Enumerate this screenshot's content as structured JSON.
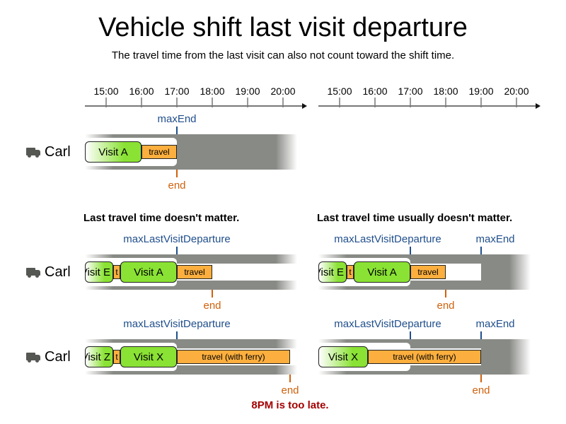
{
  "title": "Vehicle shift last visit departure",
  "subtitle": "The travel time from the last visit can also not count toward the shift time.",
  "axes": {
    "tick_labels": [
      "15:00",
      "16:00",
      "17:00",
      "18:00",
      "19:00",
      "20:00"
    ]
  },
  "colors": {
    "visit": "#8ae234",
    "travel": "#fcaf3e",
    "unavailable": "#888a85",
    "constraint_marker": "#204f8c",
    "end_marker": "#d0610b",
    "warning": "#a40000"
  },
  "top_example": {
    "vehicle": "Carl",
    "marker_max_end": "maxEnd",
    "marker_end": "end",
    "visit": "Visit A",
    "travel": "travel"
  },
  "left_panel": {
    "heading": "Last travel time doesn't matter.",
    "row1": {
      "vehicle": "Carl",
      "marker_max_last_visit_departure": "maxLastVisitDeparture",
      "marker_end": "end",
      "prev_visit": "Visit E",
      "short_travel": "t",
      "visit": "Visit A",
      "travel": "travel"
    },
    "row2": {
      "vehicle": "Carl",
      "marker_max_last_visit_departure": "maxLastVisitDeparture",
      "marker_end": "end",
      "prev_visit": "Visit Z",
      "short_travel": "t",
      "visit": "Visit X",
      "travel": "travel (with ferry)"
    },
    "warning": "8PM is too late."
  },
  "right_panel": {
    "heading": "Last travel time usually doesn't matter.",
    "row1": {
      "marker_max_last_visit_departure": "maxLastVisitDeparture",
      "marker_max_end": "maxEnd",
      "marker_end": "end",
      "prev_visit": "Visit E",
      "short_travel": "t",
      "visit": "Visit A",
      "travel": "travel"
    },
    "row2": {
      "marker_max_last_visit_departure": "maxLastVisitDeparture",
      "marker_max_end": "maxEnd",
      "marker_end": "end",
      "visit": "Visit X",
      "travel": "travel (with ferry)"
    }
  }
}
